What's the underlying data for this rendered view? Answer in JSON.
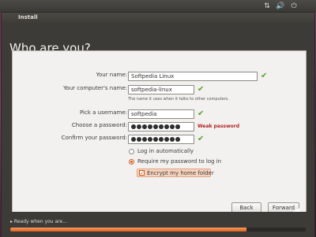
{
  "panel_tray": {
    "icons": [
      "network-icon",
      "volume-icon",
      "power-icon"
    ]
  },
  "window": {
    "title": "Install",
    "page_title": "Who are you?"
  },
  "form": {
    "name_label": "Your name:",
    "name_value": "Softpedia Linux",
    "computer_label": "Your computer's name:",
    "computer_value": "softpedia-linux",
    "computer_hint": "The name it uses when it talks to other computers.",
    "username_label": "Pick a username:",
    "username_value": "softpedia",
    "password_label": "Choose a password:",
    "password_dots": 9,
    "password_strength": "Weak password",
    "confirm_label": "Confirm your password:",
    "confirm_dots": 9
  },
  "login_options": {
    "auto_login_label": "Log in automatically",
    "require_password_label": "Require my password to log in",
    "encrypt_label": "Encrypt my home folder",
    "selected": "require_password",
    "encrypt_checked": true
  },
  "buttons": {
    "back": "Back",
    "forward": "Forward"
  },
  "status": {
    "ready_text": "Ready when you are...",
    "progress": 0.8
  },
  "colors": {
    "accent": "#e0611e",
    "check_green": "#5aa02c",
    "weak_red": "#b22222"
  }
}
